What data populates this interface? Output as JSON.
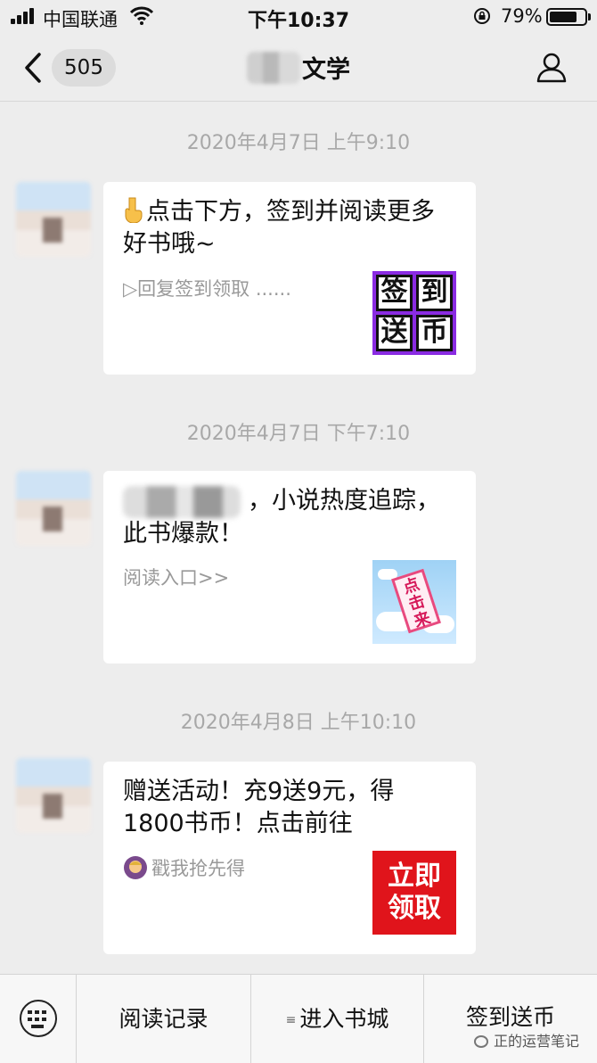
{
  "status_bar": {
    "carrier": "中国联通",
    "time": "下午10:37",
    "battery_percent": "79%",
    "battery_level": 0.79
  },
  "nav": {
    "unread_count": "505",
    "title": "文学"
  },
  "messages": [
    {
      "timestamp": "2020年4月7日 上午9:10",
      "title": "点击下方，签到并阅读更多好书哦~",
      "description": "▷回复签到领取 ......",
      "thumbnail": {
        "type": "sign-in",
        "labels": [
          "签",
          "到",
          "送",
          "币"
        ],
        "color": "#8a2be2"
      }
    },
    {
      "timestamp": "2020年4月7日 下午7:10",
      "title": "，小说热度追踪，此书爆款！",
      "description": "阅读入口>>",
      "thumbnail": {
        "type": "click-here",
        "label": "点击来"
      }
    },
    {
      "timestamp": "2020年4月8日 上午10:10",
      "title": "赠送活动！充9送9元，得1800书币！点击前往",
      "description": "戳我抢先得",
      "thumbnail": {
        "type": "claim",
        "lines": [
          "立即",
          "领取"
        ],
        "color": "#e0141b"
      }
    }
  ],
  "bottom_menu": {
    "items": [
      "阅读记录",
      "进入书城",
      "签到送币"
    ],
    "menu_indicator": "≡"
  },
  "watermark": "正的运营笔记"
}
